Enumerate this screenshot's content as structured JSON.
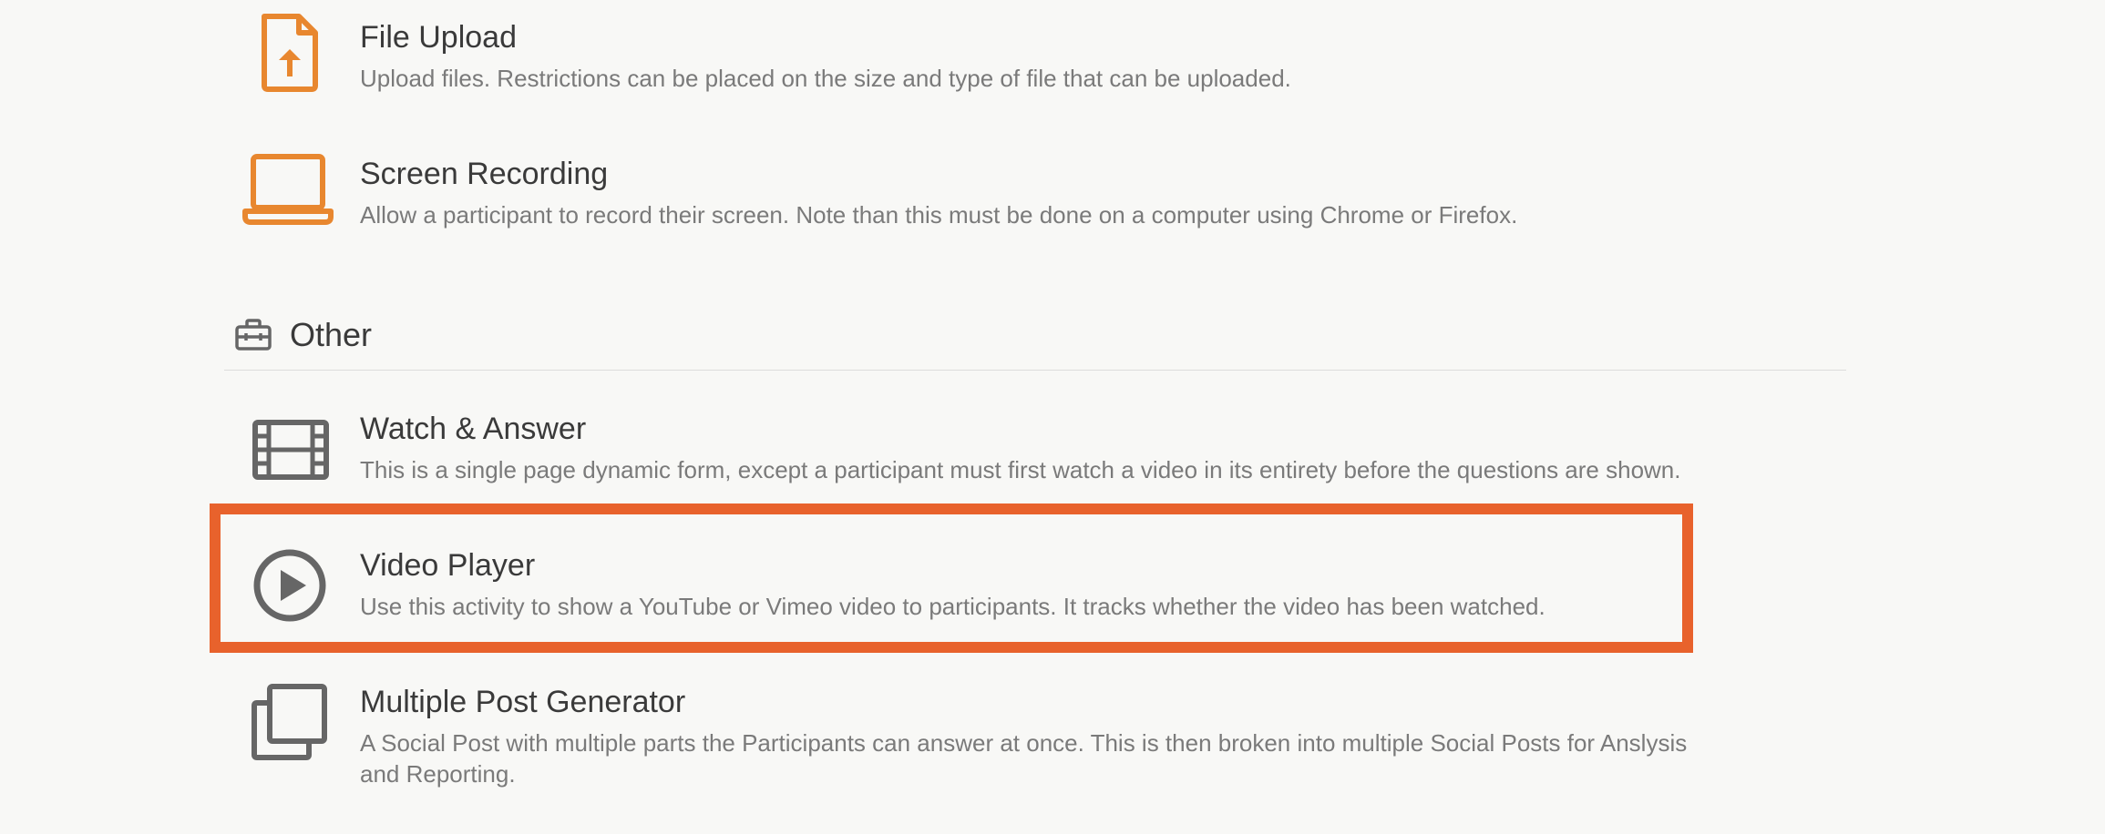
{
  "activities": {
    "file_upload": {
      "icon": "file-upload-icon",
      "title": "File Upload",
      "description": "Upload files. Restrictions can be placed on the size and type of file that can be uploaded."
    },
    "screen_recording": {
      "icon": "laptop-icon",
      "title": "Screen Recording",
      "description": "Allow a participant to record their screen. Note than this must be done on a computer using Chrome or Firefox."
    }
  },
  "other_section": {
    "icon": "toolbox-icon",
    "heading": "Other",
    "items": {
      "watch_answer": {
        "icon": "film-icon",
        "title": "Watch & Answer",
        "description": "This is a single page dynamic form, except a participant must first watch a video in its entirety before the questions are shown."
      },
      "video_player": {
        "icon": "play-circle-icon",
        "title": "Video Player",
        "description": "Use this activity to show a YouTube or Vimeo video to participants. It tracks whether the video has been watched."
      },
      "multiple_post_generator": {
        "icon": "copy-icon",
        "title": "Multiple Post Generator",
        "description_line1": "A Social Post with multiple parts the Participants can answer at once. This is then broken into multiple Social Posts for Anslysis",
        "description_line2": "and Reporting."
      }
    }
  },
  "colors": {
    "background": "#f8f8f6",
    "accent_orange": "#e8872f",
    "highlight_border": "#e8622c",
    "icon_gray": "#666666",
    "title_text": "#3a3a3a",
    "desc_text": "#7a7a7a"
  }
}
